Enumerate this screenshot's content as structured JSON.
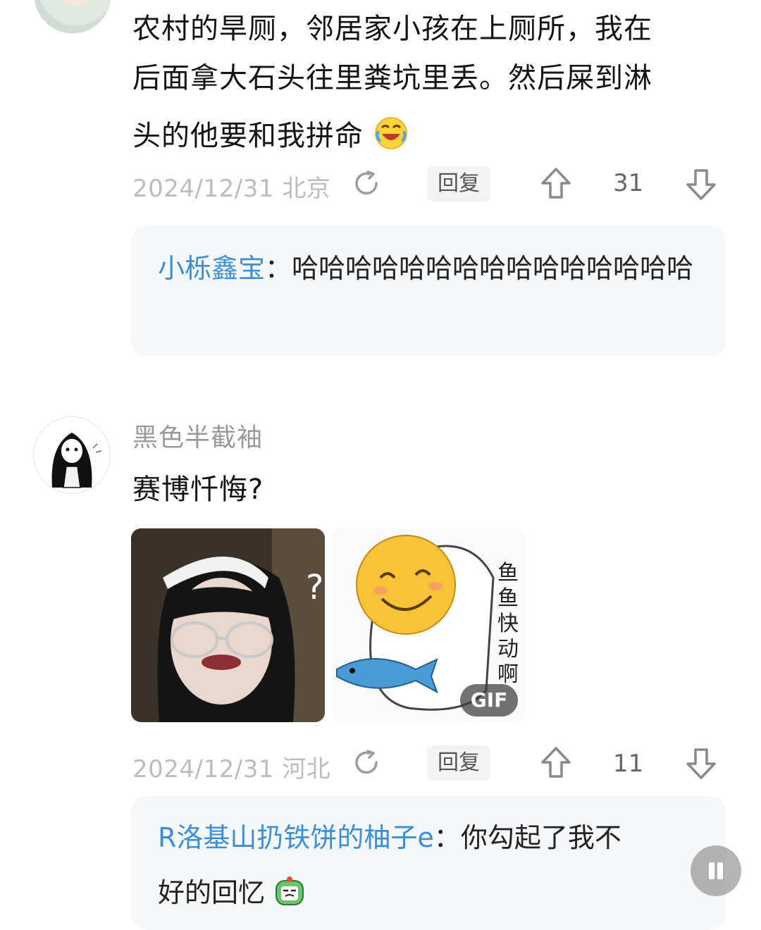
{
  "comment1": {
    "text_lines": [
      "农村的旱厕，邻居家小孩在上厕所，我在",
      "后面拿大石头往里粪坑里丢。然后屎到淋",
      "头的他要和我拼命"
    ],
    "emoji": "laughing-crying-emoji",
    "date_location": "2024/12/31 北京",
    "reply_label": "回复",
    "likes": "31",
    "reply": {
      "user": "小栎鑫宝",
      "separator": "：",
      "text": "哈哈哈哈哈哈哈哈哈哈哈哈哈哈哈"
    }
  },
  "comment2": {
    "username": "黑色半截袖",
    "text": "赛博忏悔?",
    "image2_caption": "鱼鱼快动啊",
    "gif_badge": "GIF",
    "date_location": "2024/12/31 河北",
    "reply_label": "回复",
    "likes": "11",
    "reply": {
      "user": "R洛基山扔铁饼的柚子e",
      "separator": "：",
      "text_line1": "你勾起了我不",
      "text_line2": "好的回忆"
    }
  },
  "colors": {
    "reply_user": "#3b8fd6",
    "meta_text": "#bdbdbd",
    "reply_bg": "#f6f7f9"
  }
}
